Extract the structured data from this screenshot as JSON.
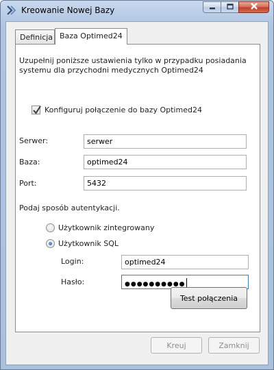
{
  "window": {
    "title": "Kreowanie Nowej Bazy",
    "icon": "database-arrow-icon"
  },
  "titlebar_buttons": {
    "minimize_icon": "minimize-icon",
    "maximize_icon": "maximize-icon",
    "close_icon": "close-icon"
  },
  "tabs": [
    {
      "label": "Definicja",
      "active": false
    },
    {
      "label": "Baza Optimed24",
      "active": true
    }
  ],
  "panel": {
    "info_text": "Uzupełnij poniższe ustawienia tylko w przypadku posiadania systemu dla przychodni medycznych Optimed24",
    "configure_checkbox": {
      "label": "Konfiguruj połączenie do bazy Optimed24",
      "checked": true
    },
    "server": {
      "label": "Serwer:",
      "value": "serwer"
    },
    "database": {
      "label": "Baza:",
      "value": "optimed24"
    },
    "port": {
      "label": "Port:",
      "value": "5432"
    },
    "auth_prompt": "Podaj sposób autentykacji.",
    "auth_options": [
      {
        "label": "Użytkownik zintegrowany",
        "selected": false
      },
      {
        "label": "Użytkownik SQL",
        "selected": true
      }
    ],
    "login": {
      "label": "Login:",
      "value": "optimed24"
    },
    "password": {
      "label": "Hasło:",
      "value": "●●●●●●●●●●"
    },
    "test_button": "Test połączenia"
  },
  "footer": {
    "create_button": "Kreuj",
    "close_button": "Zamknij"
  },
  "colors": {
    "frame": "#b7cbe5",
    "close_button": "#c0412a",
    "focus_border": "#3c7fb1",
    "radio_dot": "#1f4f8f"
  }
}
